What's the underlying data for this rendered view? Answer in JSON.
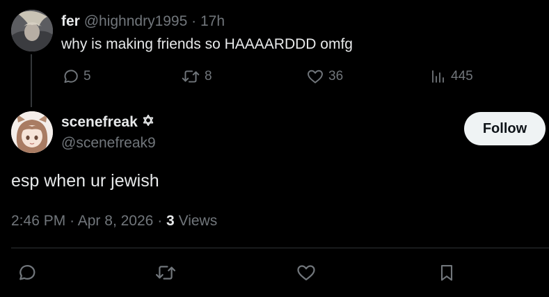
{
  "colors": {
    "background": "#000000",
    "primary_text": "#e7e9ea",
    "secondary_text": "#71767b",
    "divider": "#2f3336",
    "follow_button_bg": "#eff3f4",
    "follow_button_text": "#0f1419"
  },
  "parent_tweet": {
    "display_name": "fer",
    "handle": "@highndry1995",
    "separator": "·",
    "time_ago": "17h",
    "text": "why is making friends so HAAAARDDD omfg",
    "stats": {
      "replies": "5",
      "reposts": "8",
      "likes": "36",
      "views": "445"
    },
    "icons": {
      "reply": "reply-icon",
      "repost": "repost-icon",
      "like": "heart-icon",
      "views": "analytics-icon"
    }
  },
  "main_tweet": {
    "display_name": "scenefreak",
    "badge_icon": "star-of-david-icon",
    "handle": "@scenefreak9",
    "follow_label": "Follow",
    "text": "esp when ur jewish",
    "time": "2:46 PM",
    "separator": "·",
    "date": "Apr 8, 2026",
    "views_count": "3",
    "views_label": "Views"
  },
  "action_bar": {
    "icons": [
      "reply-icon",
      "repost-icon",
      "heart-icon",
      "bookmark-icon"
    ]
  }
}
